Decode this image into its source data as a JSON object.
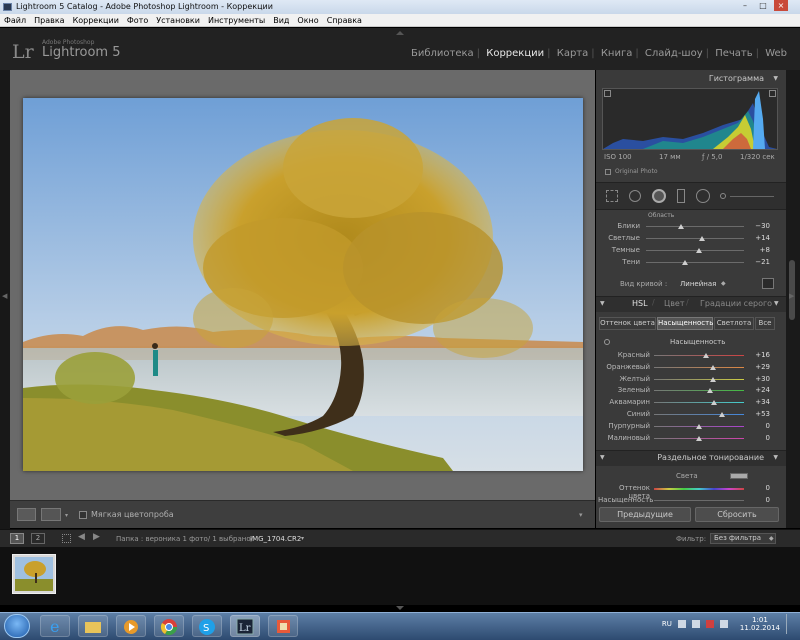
{
  "window": {
    "title": "Lightroom 5 Catalog - Adobe Photoshop Lightroom - Коррекции",
    "controls": [
      "–",
      "□",
      "×"
    ]
  },
  "menu": [
    "Файл",
    "Правка",
    "Коррекции",
    "Фото",
    "Установки",
    "Инструменты",
    "Вид",
    "Окно",
    "Справка"
  ],
  "header": {
    "logo": "Lr",
    "brand_small": "Adobe Photoshop",
    "brand": "Lightroom 5",
    "modules": [
      {
        "label": "Библиотека",
        "active": false
      },
      {
        "label": "Коррекции",
        "active": true
      },
      {
        "label": "Карта",
        "active": false
      },
      {
        "label": "Книга",
        "active": false
      },
      {
        "label": "Слайд-шоу",
        "active": false
      },
      {
        "label": "Печать",
        "active": false
      },
      {
        "label": "Web",
        "active": false
      }
    ]
  },
  "histogram": {
    "title": "Гистограмма",
    "iso": "ISO 100",
    "focal": "17 мм",
    "aperture": "ƒ / 5,0",
    "shutter": "1/320 сек",
    "original_label": "Original Photo"
  },
  "tone_curve": {
    "region_label": "Область",
    "sliders": [
      {
        "label": "Блики",
        "value": "−30",
        "pos": 0.35
      },
      {
        "label": "Светлые",
        "value": "+14",
        "pos": 0.57
      },
      {
        "label": "Темные",
        "value": "+8",
        "pos": 0.54
      },
      {
        "label": "Тени",
        "value": "−21",
        "pos": 0.4
      }
    ],
    "curve_type_label": "Вид кривой :",
    "curve_type_value": "Линейная"
  },
  "hsl": {
    "header_tabs": [
      "HSL",
      "Цвет",
      "Градации серого"
    ],
    "tabs": [
      "Оттенок цвета",
      "Насыщенность",
      "Светлота",
      "Все"
    ],
    "active_tab": 1,
    "section_label": "Насыщенность",
    "sliders": [
      {
        "label": "Красный",
        "value": "+16",
        "pos": 0.58
      },
      {
        "label": "Оранжевый",
        "value": "+29",
        "pos": 0.65
      },
      {
        "label": "Желтый",
        "value": "+30",
        "pos": 0.65
      },
      {
        "label": "Зеленый",
        "value": "+24",
        "pos": 0.62
      },
      {
        "label": "Аквамарин",
        "value": "+34",
        "pos": 0.67
      },
      {
        "label": "Синий",
        "value": "+53",
        "pos": 0.76
      },
      {
        "label": "Пурпурный",
        "value": "0",
        "pos": 0.5
      },
      {
        "label": "Малиновый",
        "value": "0",
        "pos": 0.5
      }
    ]
  },
  "split_toning": {
    "title": "Раздельное тонирование",
    "highlights_label": "Света",
    "sliders": [
      {
        "label": "Оттенок цвета",
        "value": "0"
      },
      {
        "label": "Насыщенность",
        "value": "0"
      }
    ]
  },
  "bottom_buttons": {
    "previous": "Предыдущие",
    "reset": "Сбросить"
  },
  "toolbar": {
    "soft_proof": "Мягкая цветопроба"
  },
  "filmstrip": {
    "page1": "1",
    "page2": "2",
    "folder_info": "Папка : вероника   1 фото/ 1 выбрано/",
    "filename": "IMG_1704.CR2",
    "filter_label": "Фильтр:",
    "filter_value": "Без фильтра"
  },
  "taskbar": {
    "lang": "RU",
    "time": "1:01",
    "date": "11.02.2014",
    "apps": [
      "ie-icon",
      "folder-icon",
      "media-player-icon",
      "chrome-icon",
      "skype-icon",
      "lightroom-icon",
      "paint-icon"
    ]
  }
}
